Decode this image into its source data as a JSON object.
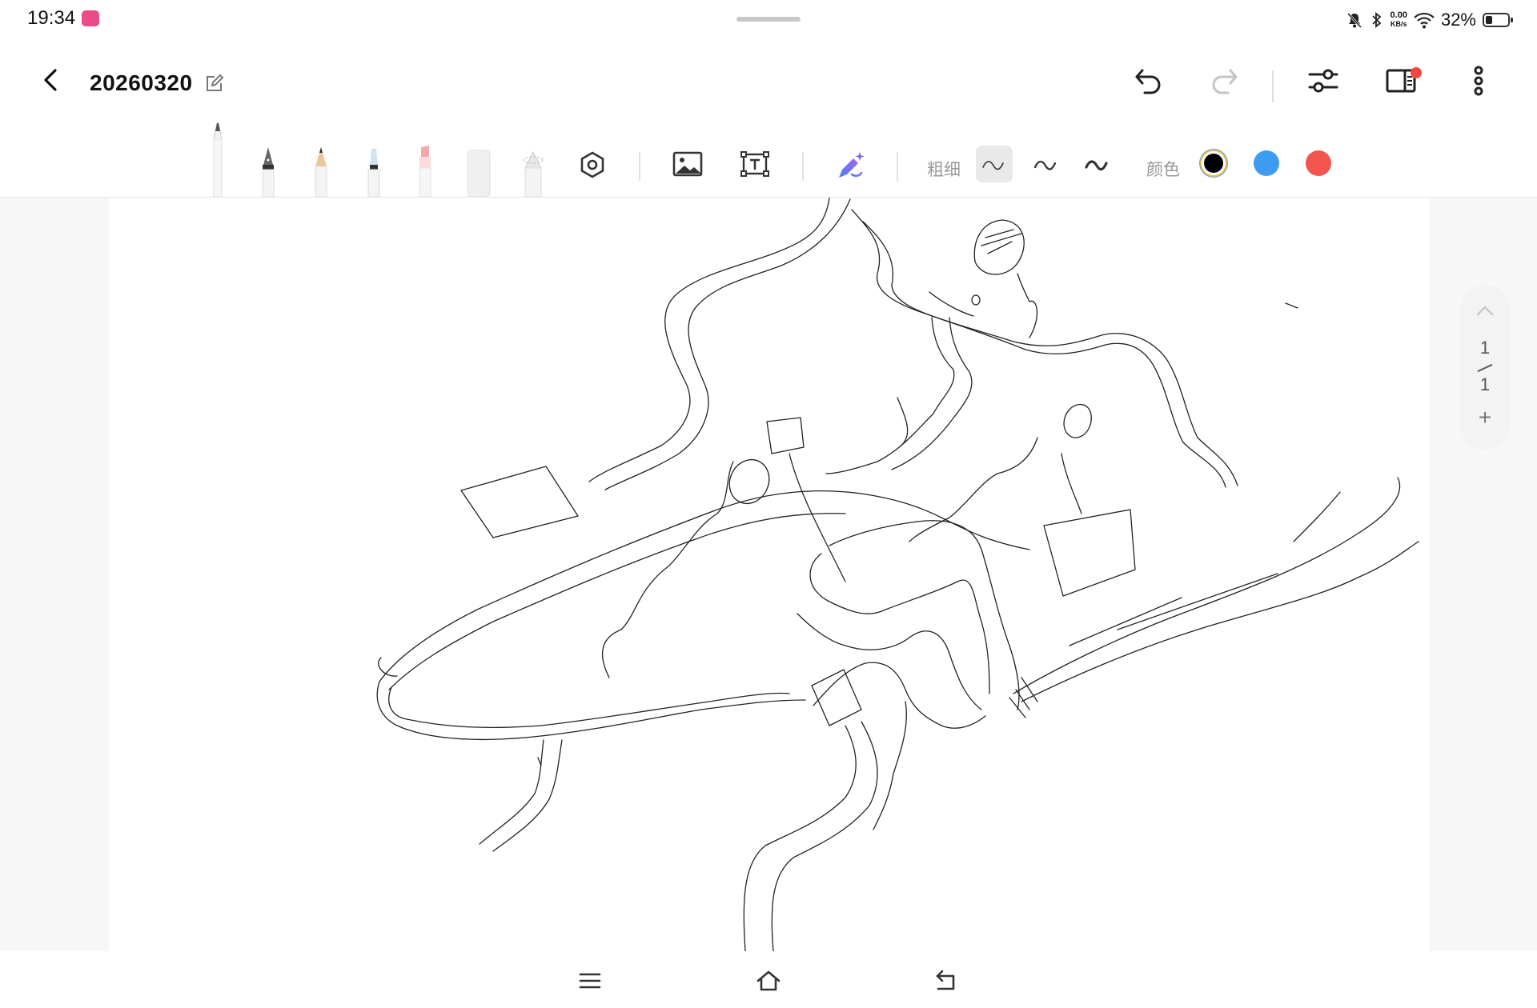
{
  "status_bar": {
    "time": "19:34",
    "speed_value": "0.00",
    "speed_unit": "KB/s",
    "battery_text": "32%",
    "battery_level_percent": 32,
    "icons": [
      "app-notification-icon",
      "mute-icon",
      "bluetooth-icon",
      "wifi-icon",
      "battery-icon"
    ]
  },
  "header": {
    "title": "20260320",
    "icons": [
      "back-arrow-icon",
      "edit-icon",
      "undo-icon",
      "redo-icon",
      "adjust-settings-icon",
      "split-panel-icon",
      "more-vertical-icon"
    ]
  },
  "toolbar": {
    "tools": [
      "ballpoint-pen",
      "fountain-pen",
      "pencil",
      "marker",
      "highlighter",
      "eraser",
      "lasso",
      "shape-tool",
      "image-insert",
      "text-box",
      "ai-pen"
    ],
    "thickness_label": "粗细",
    "color_label": "颜色",
    "stroke_selected_index": 0,
    "colors": [
      "#000000",
      "#3d9cf0",
      "#f2544e"
    ],
    "selected_color_index": 0
  },
  "page_nav": {
    "current": "1",
    "total": "1",
    "add": "+"
  },
  "bottom_nav": {
    "icons": [
      "menu-icon",
      "home-icon",
      "back-icon"
    ]
  }
}
